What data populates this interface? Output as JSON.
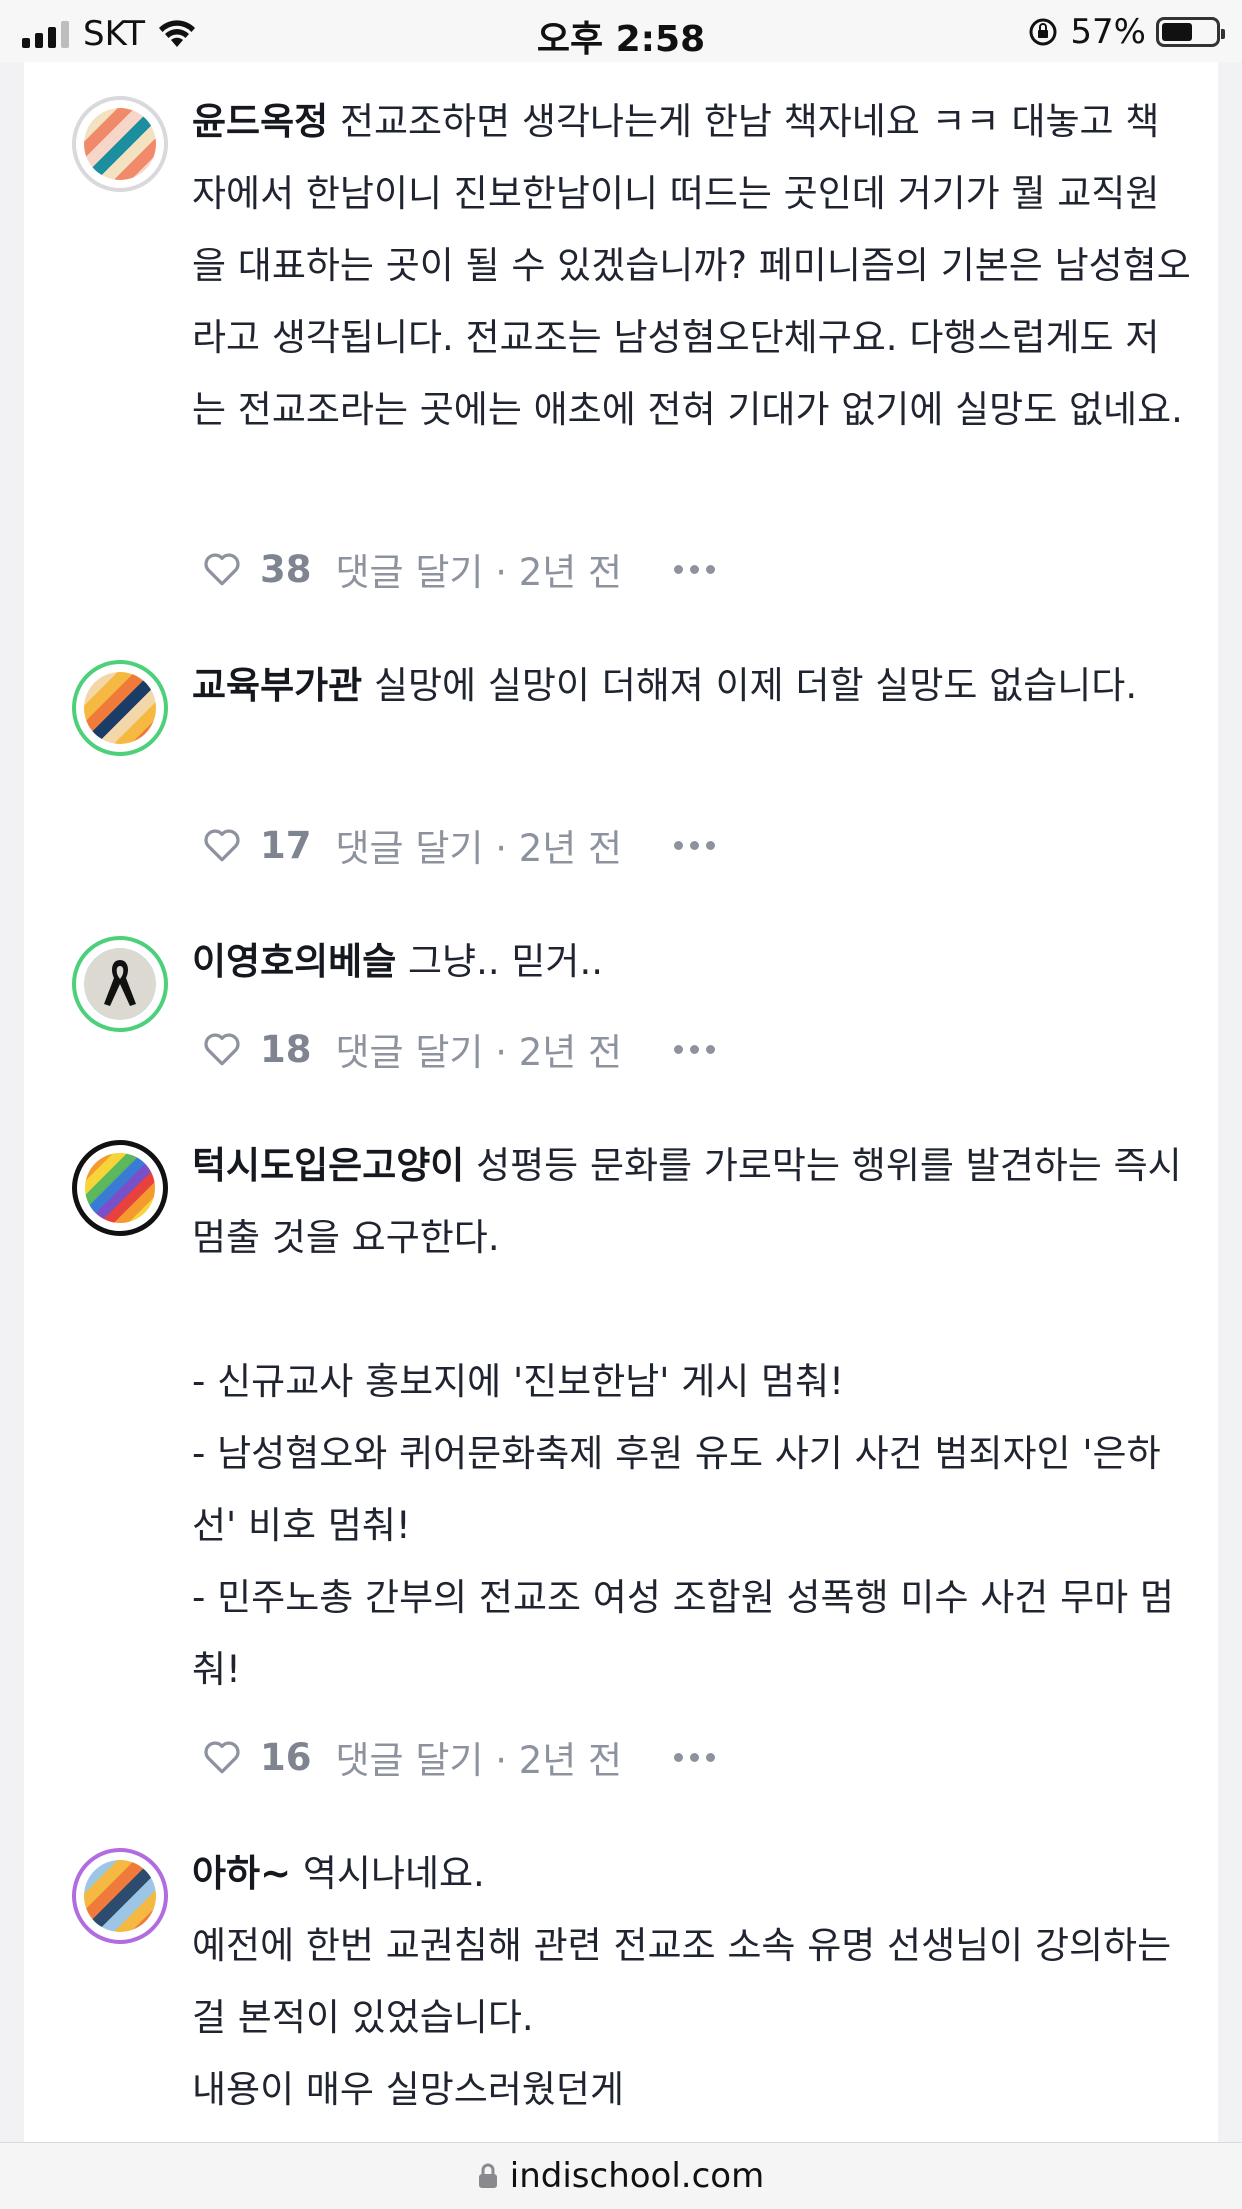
{
  "status_bar": {
    "carrier": "SKT",
    "time": "오후 2:58",
    "battery": "57%",
    "battery_level": 0.57
  },
  "comments": [
    {
      "author": "윤드옥정",
      "body": "전교조하면 생각나는게 한남 책자네요 ㅋㅋ 대놓고 책자에서 한남이니 진보한남이니 떠드는 곳인데 거기가 뭘 교직원을 대표하는 곳이 될 수 있겠습니까? 페미니즘의 기본은 남성혐오라고 생각됩니다. 전교조는 남성혐오단체구요. 다행스럽게도 저는 전교조라는 곳에는 애초에 전혀 기대가 없기에 실망도 없네요.",
      "likes": "38",
      "reply": "댓글 달기",
      "time": "· 2년 전",
      "avatar": "striped-avatar-teal-orange"
    },
    {
      "author": "교육부가관",
      "body": "실망에 실망이 더해져 이제 더할 실망도 없습니다.",
      "likes": "17",
      "reply": "댓글 달기",
      "time": "· 2년 전",
      "avatar": "striped-avatar-navy-orange"
    },
    {
      "author": "이영호의베슬",
      "body": "그냥.. 믿거..",
      "likes": "18",
      "reply": "댓글 달기",
      "time": "· 2년 전",
      "avatar": "black-ribbon-avatar"
    },
    {
      "author": "턱시도입은고양이",
      "body": "성평등 문화를 가로막는 행위를 발견하는 즉시 멈출 것을 요구한다.\n\n- 신규교사 홍보지에 '진보한남' 게시 멈춰!\n- 남성혐오와 퀴어문화축제 후원 유도 사기 사건 범죄자인 '은하선' 비호 멈춰!\n- 민주노총 간부의 전교조 여성 조합원 성폭행 미수 사건 무마 멈춰!",
      "likes": "16",
      "reply": "댓글 달기",
      "time": "· 2년 전",
      "avatar": "rainbow-avatar"
    },
    {
      "author": "아하~",
      "body": "역시나네요.\n예전에 한번 교권침해 관련 전교조 소속 유명 선생님이 강의하는걸 본적이 있었습니다.\n내용이 매우 실망스러웠던게",
      "avatar": "striped-avatar-blue-orange"
    }
  ],
  "url_bar": {
    "url": "indischool.com",
    "icon": "lock-icon"
  },
  "colors": {
    "ring_green": "#4cd07a",
    "ring_purple": "#b36be0",
    "ring_gray": "#d9d9dd",
    "ring_black": "#111111"
  }
}
